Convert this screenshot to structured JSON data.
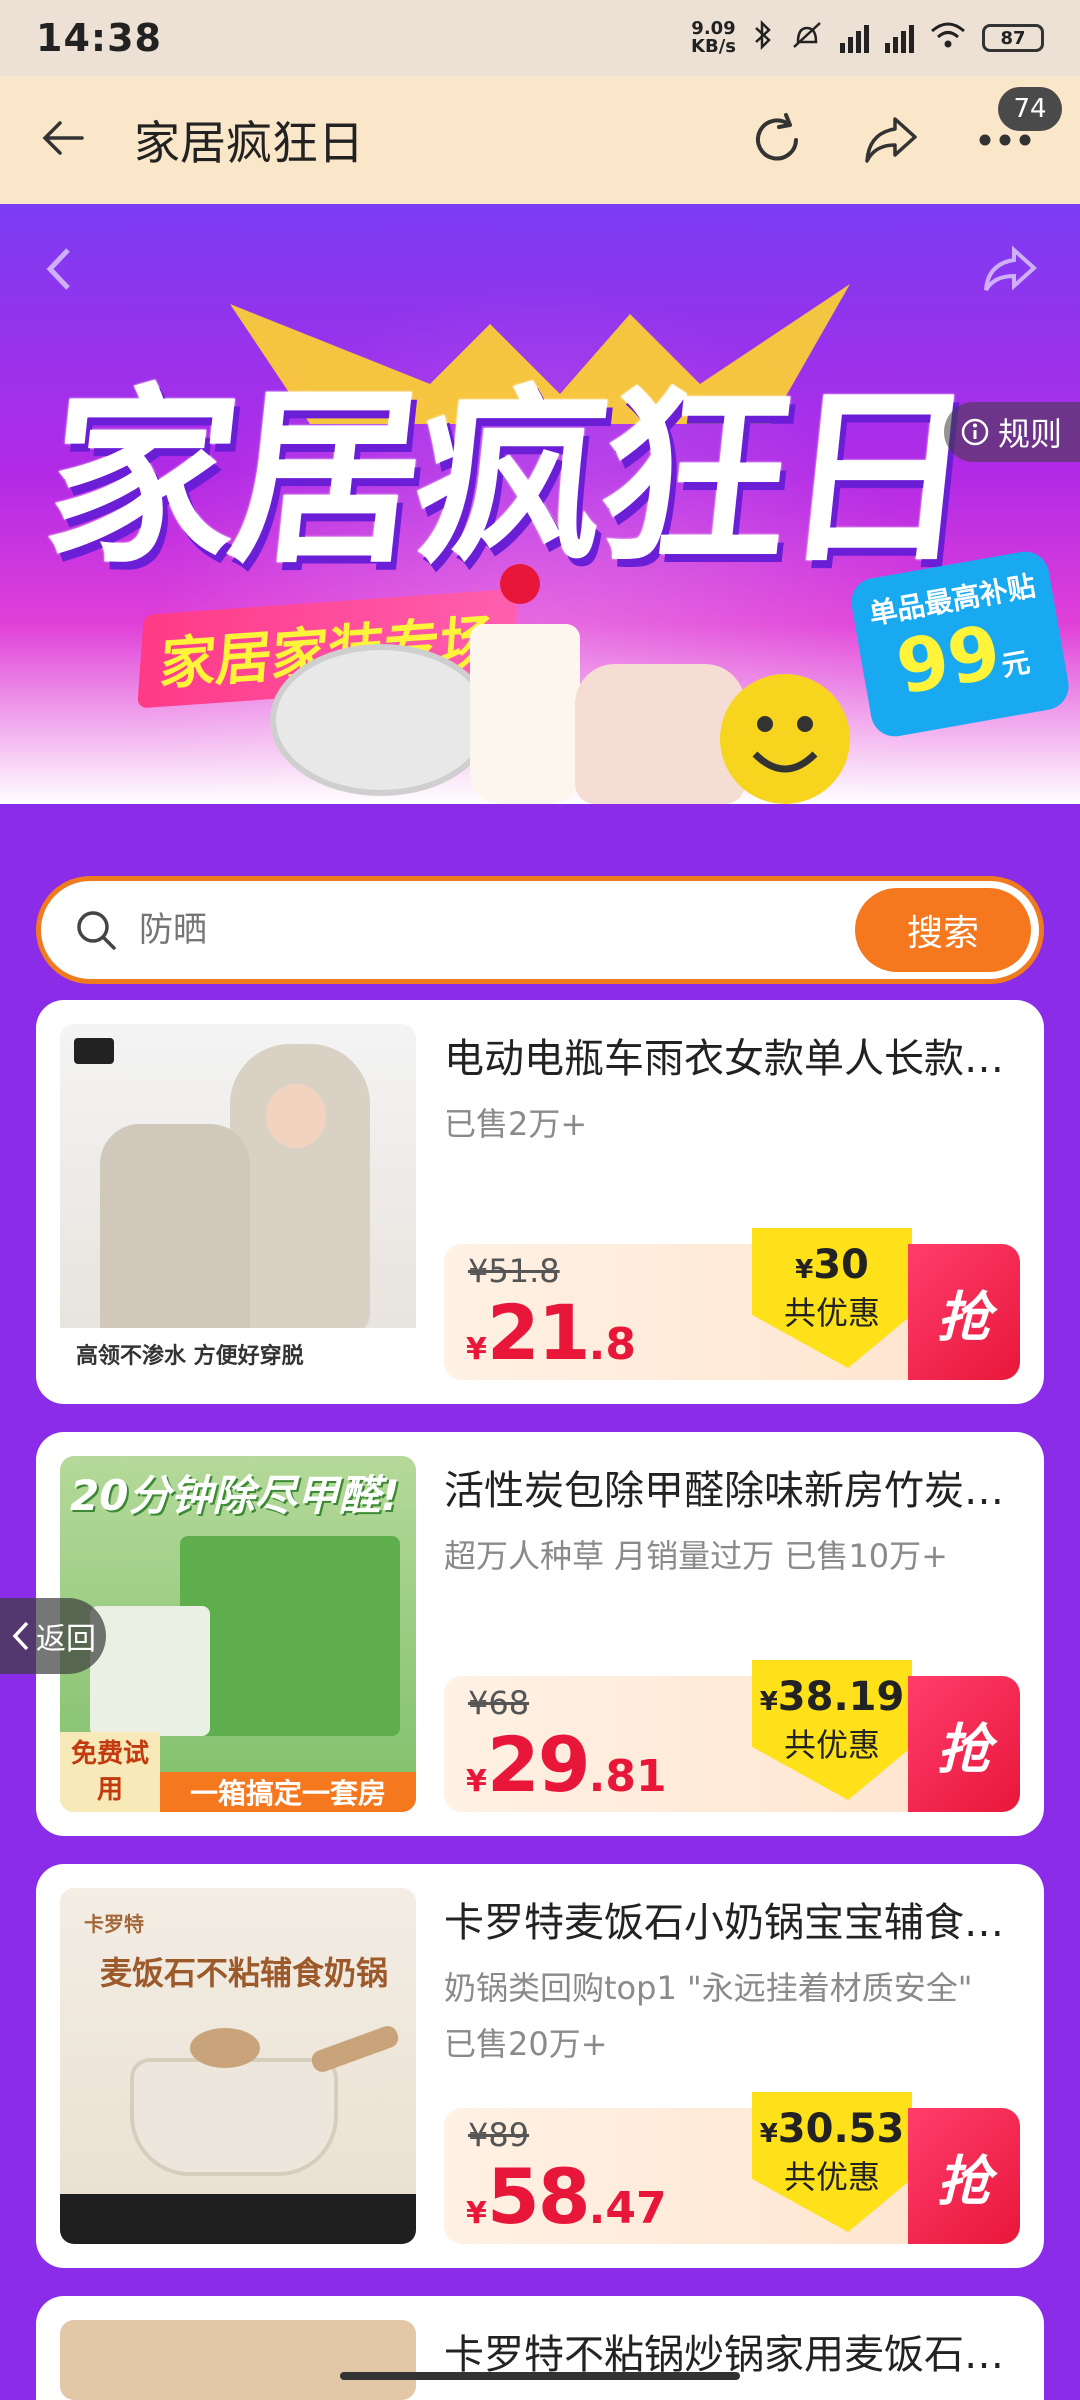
{
  "status_bar": {
    "time": "14:38",
    "net_speed_value": "9.09",
    "net_speed_unit": "KB/s",
    "battery": "87"
  },
  "nav": {
    "title": "家居疯狂日",
    "badge_count": "74"
  },
  "banner": {
    "title": "家居疯狂日",
    "subtitle": "家居家装专场",
    "rules_label": "规则",
    "subsidy_label": "单品最高补贴",
    "subsidy_amount": "99",
    "subsidy_unit": "元"
  },
  "search": {
    "placeholder": "防晒",
    "button_label": "搜索"
  },
  "products": [
    {
      "title": "电动电瓶车雨衣女款单人长款…",
      "meta": "已售2万+",
      "old_price": "¥51.8",
      "price_currency": "¥",
      "price_int": "21",
      "price_dec": ".8",
      "discount_amount": "30",
      "discount_label": "共优惠",
      "grab_label": "抢",
      "image_caption": "高领不渗水  方便好穿脱"
    },
    {
      "title": "活性炭包除甲醛除味新房竹炭…",
      "meta": "超万人种草  月销量过万  已售10万+",
      "old_price": "¥68",
      "price_currency": "¥",
      "price_int": "29",
      "price_dec": ".81",
      "discount_amount": "38.19",
      "discount_label": "共优惠",
      "grab_label": "抢",
      "image_headline": "20分钟除尽甲醛!",
      "image_caption": "一箱搞定一套房",
      "image_tag": "免费试用"
    },
    {
      "title": "卡罗特麦饭石小奶锅宝宝辅食…",
      "meta": "奶锅类回购top1 \"永远挂着材质安全\"\n已售20万+",
      "old_price": "¥89",
      "price_currency": "¥",
      "price_int": "58",
      "price_dec": ".47",
      "discount_amount": "30.53",
      "discount_label": "共优惠",
      "grab_label": "抢",
      "image_brand": "卡罗特",
      "image_headline": "麦饭石不粘辅食奶锅"
    },
    {
      "title": "卡罗特不粘锅炒锅家用麦饭石…"
    }
  ],
  "float_back_label": "返回",
  "colors": {
    "accent_orange": "#f5781e",
    "price_red": "#e8173a",
    "page_purple": "#8a2ce8",
    "discount_yellow": "#ffe11a"
  }
}
